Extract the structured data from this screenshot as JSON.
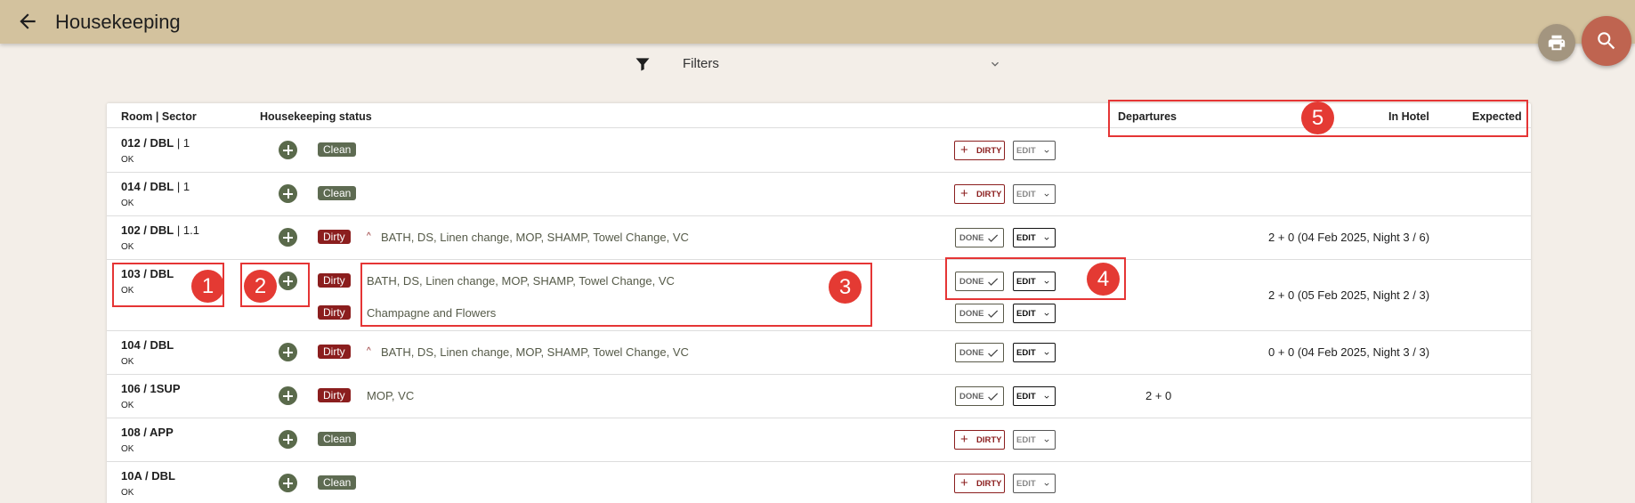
{
  "header": {
    "title": "Housekeeping"
  },
  "filters": {
    "label": "Filters"
  },
  "table": {
    "columns": {
      "room_sector": "Room | Sector",
      "status": "Housekeeping status",
      "departures": "Departures",
      "in_hotel": "In Hotel",
      "expected": "Expected"
    },
    "rows": [
      {
        "room": "012 / DBL",
        "sector": " | 1",
        "ok": "OK",
        "status": "Clean",
        "dirty_label": "DIRTY",
        "edit_label": "EDIT"
      },
      {
        "room": "014 / DBL",
        "sector": " | 1",
        "ok": "OK",
        "status": "Clean",
        "dirty_label": "DIRTY",
        "edit_label": "EDIT"
      },
      {
        "room": "102 / DBL",
        "sector": " | 1.1",
        "ok": "OK",
        "status": "Dirty",
        "tasks": "BATH, DS, Linen change, MOP, SHAMP, Towel Change, VC",
        "done_label": "DONE",
        "edit_label": "EDIT",
        "expected": "2 + 0 (04 Feb 2025, Night 3 / 6)"
      },
      {
        "room": "103 / DBL",
        "sector": "",
        "ok": "OK",
        "status": "Dirty",
        "tasks": "BATH, DS, Linen change, MOP, SHAMP, Towel Change, VC",
        "status2": "Dirty",
        "tasks2": "Champagne and Flowers",
        "done_label": "DONE",
        "edit_label": "EDIT",
        "expected": "2 + 0 (05 Feb 2025, Night 2 / 3)"
      },
      {
        "room": "104 / DBL",
        "sector": "",
        "ok": "OK",
        "status": "Dirty",
        "tasks": "BATH, DS, Linen change, MOP, SHAMP, Towel Change, VC",
        "done_label": "DONE",
        "edit_label": "EDIT",
        "expected": "0 + 0 (04 Feb 2025, Night 3 / 3)"
      },
      {
        "room": "106 / 1SUP",
        "sector": "",
        "ok": "OK",
        "status": "Dirty",
        "tasks": "MOP, VC",
        "done_label": "DONE",
        "edit_label": "EDIT",
        "departures": "2 + 0"
      },
      {
        "room": "108 / APP",
        "sector": "",
        "ok": "OK",
        "status": "Clean",
        "dirty_label": "DIRTY",
        "edit_label": "EDIT"
      },
      {
        "room": "10A / DBL",
        "sector": "",
        "ok": "OK",
        "status": "Clean",
        "dirty_label": "DIRTY",
        "edit_label": "EDIT"
      }
    ]
  },
  "annotations": [
    "1",
    "2",
    "3",
    "4",
    "5"
  ],
  "icons": {
    "back": "arrow-left-icon",
    "print": "printer-icon",
    "search": "search-icon",
    "filter": "funnel-icon",
    "expand": "chevron-down-icon",
    "add": "plus-circle-icon",
    "check": "check-icon"
  },
  "colors": {
    "topbar": "#d3c29e",
    "background": "#f3eee8",
    "clean_badge": "#5e6b52",
    "dirty_badge": "#8b1e1e",
    "search_fab": "#bf6450",
    "print_fab": "#a3957f",
    "highlight": "#e53535"
  }
}
